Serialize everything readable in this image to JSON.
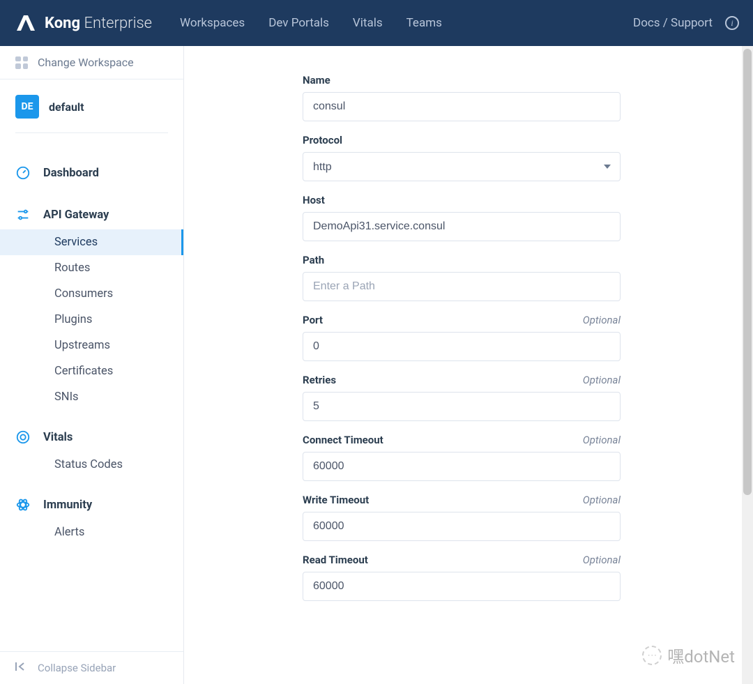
{
  "brand": {
    "name": "Kong",
    "suffix": "Enterprise"
  },
  "topnav": {
    "workspaces": "Workspaces",
    "devPortals": "Dev Portals",
    "vitals": "Vitals",
    "teams": "Teams",
    "docs": "Docs / Support"
  },
  "sidebar": {
    "changeWorkspace": "Change Workspace",
    "workspace": {
      "badge": "DE",
      "name": "default"
    },
    "dashboard": "Dashboard",
    "apiGateway": {
      "label": "API Gateway",
      "services": "Services",
      "routes": "Routes",
      "consumers": "Consumers",
      "plugins": "Plugins",
      "upstreams": "Upstreams",
      "certificates": "Certificates",
      "snis": "SNIs"
    },
    "vitals": {
      "label": "Vitals",
      "statusCodes": "Status Codes"
    },
    "immunity": {
      "label": "Immunity",
      "alerts": "Alerts"
    },
    "collapse": "Collapse Sidebar"
  },
  "form": {
    "nameLabel": "Name",
    "nameValue": "consul",
    "protocolLabel": "Protocol",
    "protocolValue": "http",
    "hostLabel": "Host",
    "hostValue": "DemoApi31.service.consul",
    "pathLabel": "Path",
    "pathPlaceholder": "Enter a Path",
    "pathValue": "",
    "portLabel": "Port",
    "portValue": "0",
    "retriesLabel": "Retries",
    "retriesValue": "5",
    "connectTimeoutLabel": "Connect Timeout",
    "connectTimeoutValue": "60000",
    "writeTimeoutLabel": "Write Timeout",
    "writeTimeoutValue": "60000",
    "readTimeoutLabel": "Read Timeout",
    "readTimeoutValue": "60000",
    "optionalText": "Optional"
  },
  "watermark": "嘿dotNet"
}
